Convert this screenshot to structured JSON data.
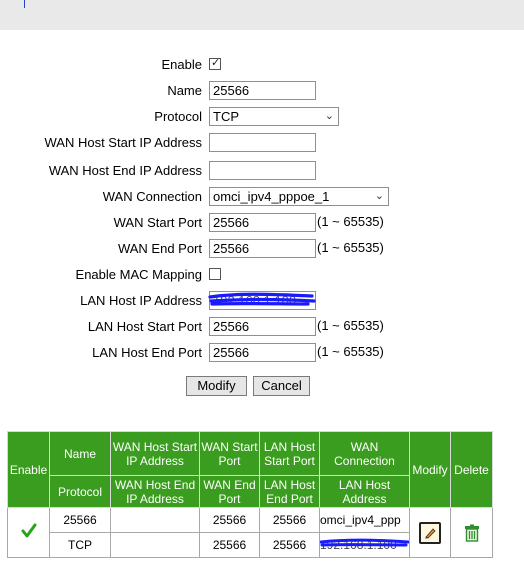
{
  "form": {
    "enable_label": "Enable",
    "enable_checked": true,
    "name_label": "Name",
    "name_value": "25566",
    "protocol_label": "Protocol",
    "protocol_value": "TCP",
    "wan_host_start_label": "WAN Host Start IP Address",
    "wan_host_start_value": "",
    "wan_host_end_label": "WAN Host End IP Address",
    "wan_host_end_value": "",
    "wan_connection_label": "WAN Connection",
    "wan_connection_value": "omci_ipv4_pppoe_1",
    "wan_start_port_label": "WAN Start Port",
    "wan_start_port_value": "25566",
    "wan_end_port_label": "WAN End Port",
    "wan_end_port_value": "25566",
    "mac_mapping_label": "Enable MAC Mapping",
    "mac_mapping_checked": false,
    "lan_host_ip_label": "LAN Host IP Address",
    "lan_host_ip_value": "192.168.1.100",
    "lan_host_start_port_label": "LAN Host Start Port",
    "lan_host_start_port_value": "25566",
    "lan_host_end_port_label": "LAN Host End Port",
    "lan_host_end_port_value": "25566",
    "port_range_hint": "(1 ~ 65535)",
    "modify_button": "Modify",
    "cancel_button": "Cancel"
  },
  "table": {
    "headers": {
      "enable": "Enable",
      "name": "Name",
      "protocol": "Protocol",
      "wan_host_start": "WAN Host Start IP Address",
      "wan_host_end": "WAN Host End IP Address",
      "wan_start_port": "WAN Start Port",
      "wan_end_port": "WAN End Port",
      "lan_host_start_port": "LAN Host Start Port",
      "lan_host_end_port": "LAN Host End Port",
      "wan_connection": "WAN Connection",
      "lan_host_address": "LAN Host Address",
      "modify": "Modify",
      "delete": "Delete"
    },
    "row": {
      "enabled_icon": "green-check-icon",
      "name": "25566",
      "protocol": "TCP",
      "wan_host_start": "",
      "wan_host_end": "",
      "wan_start_port": "25566",
      "wan_end_port": "25566",
      "lan_host_start_port": "25566",
      "lan_host_end_port": "25566",
      "wan_connection": "omci_ipv4_ppp",
      "lan_host_address": "192.168.1.100"
    }
  },
  "colors": {
    "header_green": "#3b9d1f",
    "check_green": "#2aa31a",
    "redaction_blue": "#1a1aff"
  }
}
